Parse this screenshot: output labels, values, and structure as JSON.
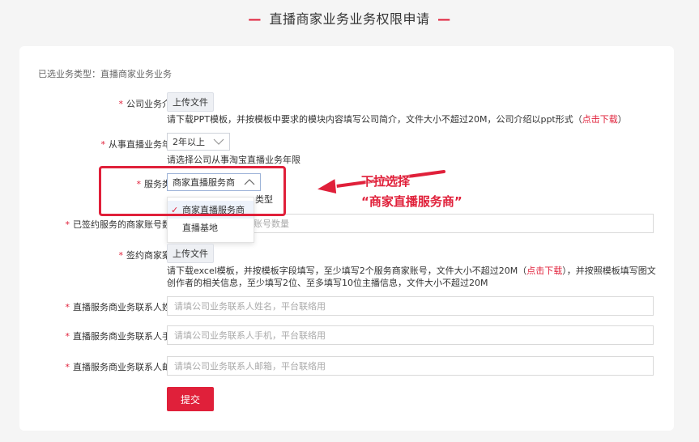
{
  "page": {
    "title": "直播商家业务业务权限申请",
    "dash_left": "—",
    "dash_right": "—"
  },
  "form": {
    "selected_type": "已选业务类型：直播商家业务业务",
    "intro": {
      "label": "公司业务介绍",
      "button": "上传文件",
      "hint_before": "请下载PPT模板，并按模板中要求的模块内容填写公司简介，文件大小不超过20M，公司介绍以ppt形式（",
      "link": "点击下载",
      "hint_after": "）"
    },
    "years": {
      "label": "从事直播业务年限",
      "value": "2年以上",
      "hint": "请选择公司从事淘宝直播业务年限"
    },
    "service_type": {
      "label": "服务类型",
      "value": "商家直播服务商",
      "hint_tail": "类型",
      "options": [
        "商家直播服务商",
        "直播基地"
      ],
      "selected_index": 0
    },
    "accounts": {
      "label": "已签约服务的商家账号数量",
      "placeholder_tail": "账号数量"
    },
    "cases": {
      "label": "签约商家案例",
      "button": "上传文件",
      "hint_line1_before": "请下载excel模板，并按模板字段填写，至少填写2个服务商家账号，文件大小不超过20M（",
      "link": "点击下载",
      "hint_line1_after": "），并按照模板填写图文",
      "hint_line2": "创作者的相关信息，至少填写2位、至多填写10位主播信息，文件大小不超过20M"
    },
    "contact_name": {
      "label": "直播服务商业务联系人姓名",
      "placeholder": "请填公司业务联系人姓名，平台联络用"
    },
    "contact_phone": {
      "label": "直播服务商业务联系人手机",
      "placeholder": "请填公司业务联系人手机，平台联络用"
    },
    "contact_email": {
      "label": "直播服务商业务联系人邮箱",
      "placeholder": "请填公司业务联系人邮箱，平台联络用"
    },
    "required_mark": "*",
    "submit": "提交"
  },
  "annotation": {
    "line1": "下拉选择",
    "line2": "“商家直播服务商”"
  },
  "colors": {
    "accent": "#e0203a",
    "background": "#f5f5f5",
    "card": "#ffffff"
  },
  "icons": {
    "chevron": "chevron-down-icon",
    "check": "check-icon",
    "arrow": "arrow-left-icon"
  }
}
